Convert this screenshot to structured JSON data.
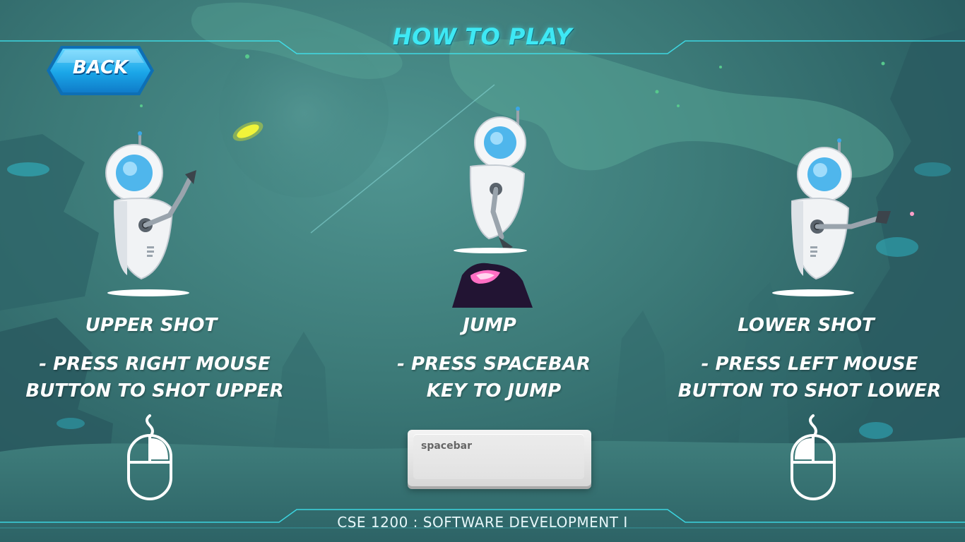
{
  "title": "HOW TO PLAY",
  "back_button": {
    "label": "BACK"
  },
  "columns": [
    {
      "heading": "UPPER SHOT",
      "lines": [
        "- PRESS RIGHT MOUSE",
        "BUTTON TO SHOT UPPER"
      ],
      "input_icon": "mouse-icon"
    },
    {
      "heading": "JUMP",
      "lines": [
        "- PRESS SPACEBAR",
        "KEY TO JUMP"
      ],
      "input_icon": "spacebar-key"
    },
    {
      "heading": "LOWER SHOT",
      "lines": [
        "- PRESS LEFT MOUSE",
        "BUTTON TO SHOT LOWER"
      ],
      "input_icon": "mouse-icon"
    }
  ],
  "spacebar_key": {
    "label": "spacebar"
  },
  "footer": "CSE 1200 : SOFTWARE DEVELOPMENT I",
  "colors": {
    "accent": "#3ee8f4",
    "button": "#1aa6e8",
    "text": "#ffffff"
  }
}
